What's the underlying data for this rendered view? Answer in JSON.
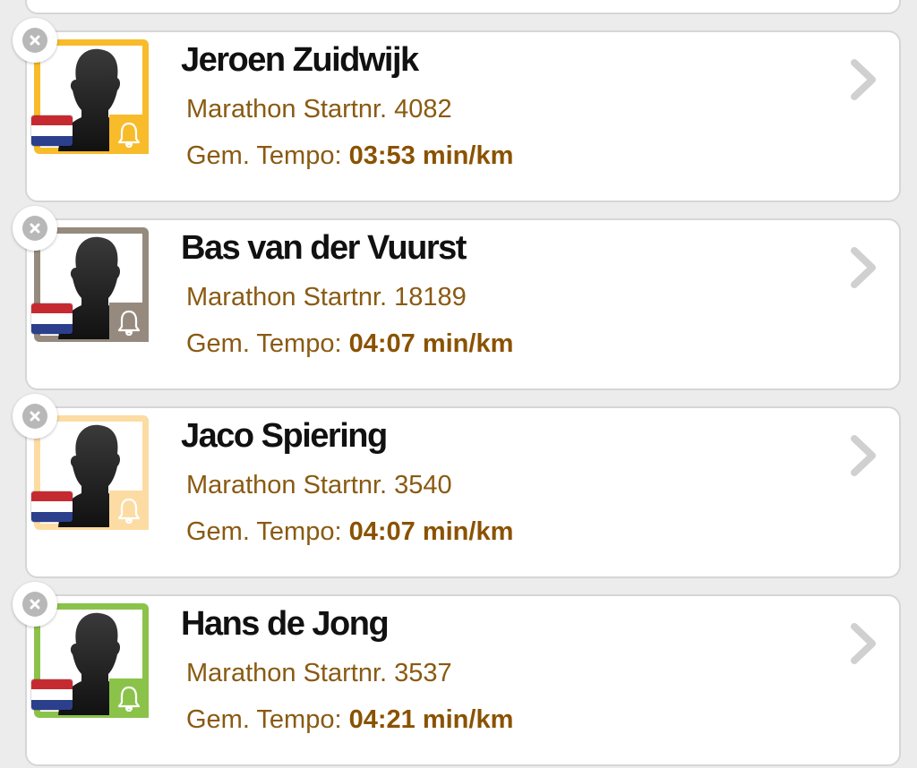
{
  "colors": {
    "card_border": "#d6d6d6",
    "text_secondary": "#8a5a12",
    "text_value": "#8a5200",
    "name": "#111111"
  },
  "runners": [
    {
      "name": "Jeroen Zuidwijk",
      "event_label": "Marathon Startnr.",
      "start_number": "4082",
      "tempo_label": "Gem. Tempo:",
      "tempo_value": "03:53 min/km",
      "frame_color": "#f8bb2a",
      "flag": "netherlands-flag",
      "icons": [
        "close-icon",
        "silhouette-avatar",
        "bell-icon",
        "chevron-right-icon"
      ]
    },
    {
      "name": "Bas van der Vuurst",
      "event_label": "Marathon Startnr.",
      "start_number": "18189",
      "tempo_label": "Gem. Tempo:",
      "tempo_value": "04:07 min/km",
      "frame_color": "#968a7e",
      "flag": "netherlands-flag",
      "icons": [
        "close-icon",
        "silhouette-avatar",
        "bell-icon",
        "chevron-right-icon"
      ]
    },
    {
      "name": "Jaco Spiering",
      "event_label": "Marathon Startnr.",
      "start_number": "3540",
      "tempo_label": "Gem. Tempo:",
      "tempo_value": "04:07 min/km",
      "frame_color": "#fcdca3",
      "flag": "netherlands-flag",
      "icons": [
        "close-icon",
        "silhouette-avatar",
        "bell-icon",
        "chevron-right-icon"
      ]
    },
    {
      "name": "Hans de Jong",
      "event_label": "Marathon Startnr.",
      "start_number": "3537",
      "tempo_label": "Gem. Tempo:",
      "tempo_value": "04:21 min/km",
      "frame_color": "#8bc34a",
      "flag": "netherlands-flag",
      "icons": [
        "close-icon",
        "silhouette-avatar",
        "bell-icon",
        "chevron-right-icon"
      ]
    }
  ]
}
